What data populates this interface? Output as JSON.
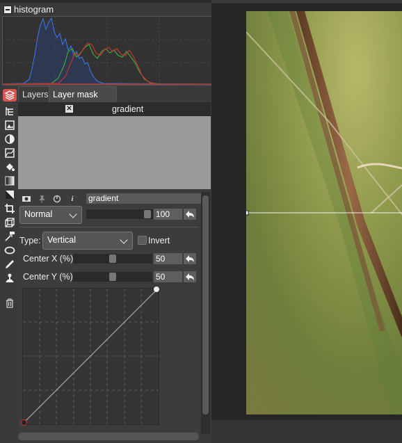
{
  "histogram": {
    "title": "histogram"
  },
  "tabs": [
    {
      "label": "Layers"
    },
    {
      "label": "Layer mask"
    }
  ],
  "layer_list": {
    "items": [
      {
        "name": "gradient"
      }
    ]
  },
  "properties": {
    "layer_name": "gradient",
    "blend_mode": "Normal",
    "opacity": "100",
    "type_label": "Type:",
    "type_value": "Vertical",
    "invert_label": "Invert",
    "invert_checked": false,
    "center_x_label": "Center X (%)",
    "center_x_value": "50",
    "center_y_label": "Center Y (%)",
    "center_y_value": "50"
  },
  "toolbar": {
    "icons": [
      "layers-icon",
      "tree-icon",
      "image-icon",
      "contrast-icon",
      "curves-icon",
      "paint-bucket-icon",
      "gradient-icon",
      "levels-icon",
      "crop-icon",
      "transform-icon",
      "clone-icon",
      "ellipse-icon",
      "brush-icon",
      "stamp-icon",
      "trash-icon"
    ]
  },
  "colors": {
    "panel_bg": "#3a3a3a",
    "accent_tab": "#d9534f",
    "histogram_blue": "#3b6fd8",
    "histogram_green": "#3ea63e",
    "histogram_red": "#c83232"
  }
}
